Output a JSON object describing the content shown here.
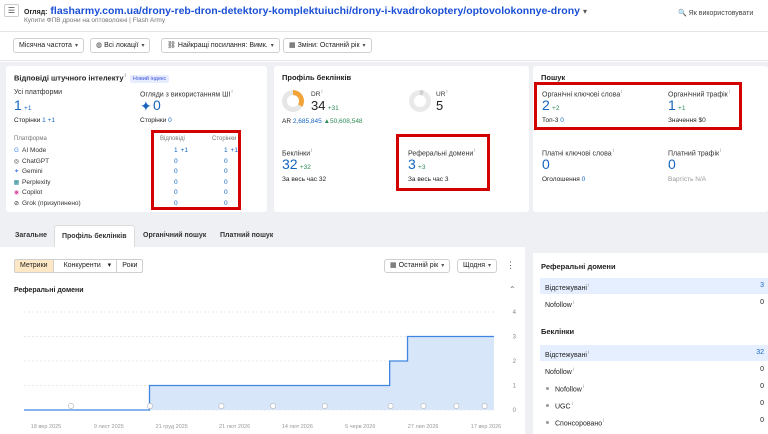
{
  "header": {
    "label": "Огляд:",
    "url": "flasharmy.com.ua/drony-reb-dron-detektory-komplektuiuchi/drony-i-kvadrokoptery/optovolokonnye-drony",
    "subtitle": "Купити ФПВ дрони на оптоволокні | Flash Army",
    "help": "Як використовувати"
  },
  "filters": {
    "frequency": "Місячна частота",
    "locations": "Всі локації",
    "links": "Найкращі посилання: Вимк.",
    "changes": "Зміни: Останній рік"
  },
  "ai": {
    "title": "Відповіді штучного інтелекту",
    "badge": "Новий індекс",
    "all_platforms_label": "Усі платформи",
    "all_value": "1",
    "all_delta": "+1",
    "pages_label": "Сторінки",
    "pages_value": "1",
    "pages_delta": "+1",
    "overview_label": "Огляди з використанням ШІ",
    "overview_pages_label": "Сторінки",
    "overview_pages_value": "0",
    "col_platform": "Платформа",
    "col_answers": "Відповіді",
    "col_pages": "Сторінки",
    "platforms": [
      {
        "icon": "google-icon",
        "glyph": "G",
        "color": "#4285f4",
        "name": "AI Mode",
        "answers": "1",
        "answers_delta": "+1",
        "pages": "1",
        "pages_delta": "+1"
      },
      {
        "icon": "chatgpt-icon",
        "glyph": "◎",
        "color": "#333333",
        "name": "ChatGPT",
        "answers": "0",
        "answers_delta": "",
        "pages": "0",
        "pages_delta": ""
      },
      {
        "icon": "gemini-icon",
        "glyph": "✦",
        "color": "#4a7bf0",
        "name": "Gemini",
        "answers": "0",
        "answers_delta": "",
        "pages": "0",
        "pages_delta": ""
      },
      {
        "icon": "perplexity-icon",
        "glyph": "▦",
        "color": "#20808d",
        "name": "Perplexity",
        "answers": "0",
        "answers_delta": "",
        "pages": "0",
        "pages_delta": ""
      },
      {
        "icon": "copilot-icon",
        "glyph": "◉",
        "color": "#d64ca2",
        "name": "Copilot",
        "answers": "0",
        "answers_delta": "",
        "pages": "0",
        "pages_delta": ""
      },
      {
        "icon": "grok-icon",
        "glyph": "⊘",
        "color": "#222222",
        "name": "Grok (призупинено)",
        "answers": "0",
        "answers_delta": "",
        "pages": "0",
        "pages_delta": ""
      }
    ]
  },
  "backlinks": {
    "title": "Профіль беклінків",
    "dr_label": "DR",
    "dr_value": "34",
    "dr_delta": "+31",
    "ar_label": "AR",
    "ar_value": "2,685,845",
    "ar_delta": "▲50,608,548",
    "ur_label": "UR",
    "ur_value": "5",
    "bl_label": "Беклінки",
    "bl_value": "32",
    "bl_delta": "+32",
    "bl_period": "За весь час",
    "bl_period_value": "32",
    "rd_label": "Реферальні домени",
    "rd_value": "3",
    "rd_delta": "+3",
    "rd_period": "За весь час",
    "rd_period_value": "3"
  },
  "search": {
    "title": "Пошук",
    "organic_kw_label": "Органічні ключові слова",
    "organic_kw_value": "2",
    "organic_kw_delta": "+2",
    "top3_label": "Топ-3",
    "top3_value": "0",
    "organic_traffic_label": "Органічний трафік",
    "organic_traffic_value": "1",
    "organic_traffic_delta": "+1",
    "value_label": "Значення",
    "value_value": "$0",
    "paid_kw_label": "Платні ключові слова",
    "paid_kw_value": "0",
    "ads_label": "Оголошення",
    "ads_value": "0",
    "paid_traffic_label": "Платний трафік",
    "paid_traffic_value": "0",
    "cost_label": "Вартість",
    "cost_value": "N/A"
  },
  "tabs": [
    "Загальне",
    "Профіль беклінків",
    "Органічний пошук",
    "Платний пошук"
  ],
  "toolbar": {
    "metrics": "Метрики",
    "competitors": "Конкуренти",
    "years": "Роки",
    "period": "Останній рік",
    "interval": "Щодня"
  },
  "chart_data": {
    "type": "line",
    "title": "Реферальні домени",
    "x": [
      "18 вер 2025",
      "9 лист 2025",
      "21 груд 2025",
      "21 лют 2026",
      "14 лют 2026",
      "5 черв 2026",
      "27 лип 2026",
      "17 вер 2026"
    ],
    "ylim": [
      0,
      4
    ],
    "yticks": [
      0,
      1,
      2,
      3,
      4
    ],
    "series": [
      {
        "steps": [
          [
            0,
            0
          ],
          [
            0.267,
            0
          ],
          [
            0.267,
            1
          ],
          [
            0.778,
            1
          ],
          [
            0.778,
            2
          ],
          [
            0.816,
            2
          ],
          [
            0.816,
            3
          ],
          [
            1,
            3
          ]
        ]
      }
    ]
  },
  "side": {
    "rd_title": "Реферальні домени",
    "rd_rows": [
      {
        "label": "Відстежувані",
        "value": "3"
      },
      {
        "label": "Nofollow",
        "value": "0"
      }
    ],
    "bl_title": "Беклінки",
    "bl_rows": [
      {
        "label": "Відстежувані",
        "value": "32"
      },
      {
        "label": "Nofollow",
        "value": "0"
      },
      {
        "label": "Nofollow",
        "value": "0"
      },
      {
        "label": "UGC",
        "value": "0"
      },
      {
        "label": "Спонсоровано",
        "value": "0"
      }
    ]
  }
}
